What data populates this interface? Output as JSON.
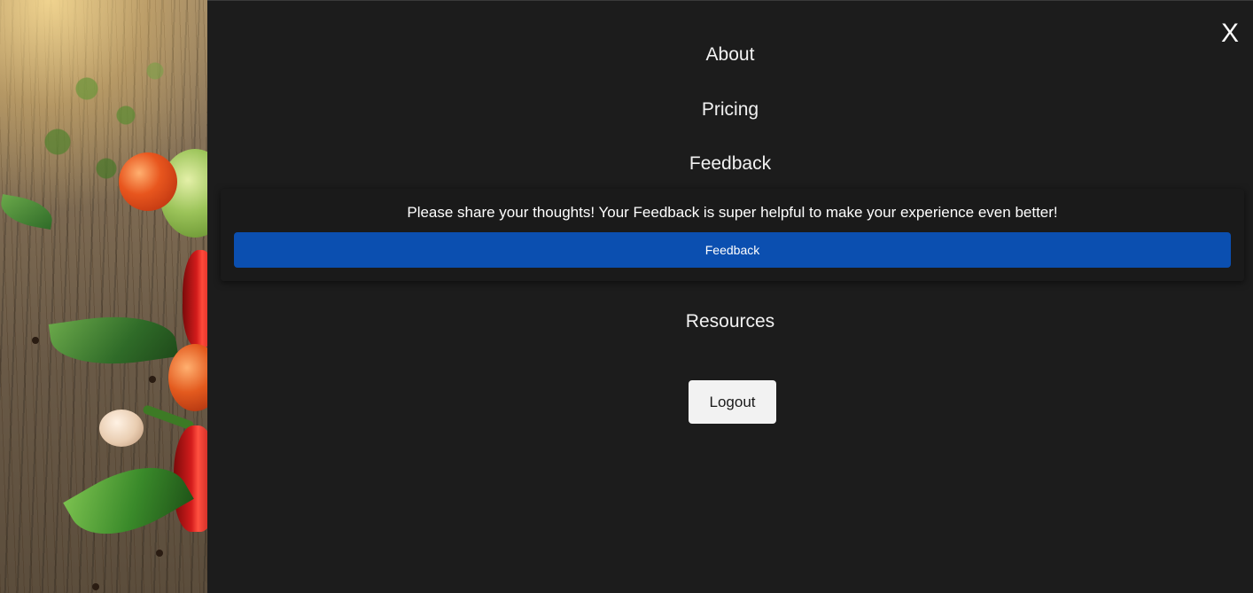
{
  "menu": {
    "close_label": "X",
    "links": {
      "about": "About",
      "pricing": "Pricing",
      "feedback": "Feedback",
      "resources": "Resources"
    }
  },
  "feedback_panel": {
    "message": "Please share your thoughts! Your Feedback is super helpful to make your experience even better!",
    "button_label": "Feedback"
  },
  "logout_label": "Logout",
  "colors": {
    "panel_background": "#1c1c1c",
    "feedback_button": "#0b4fb0",
    "logout_button": "#f2f2f2",
    "text": "#f2f2f2"
  }
}
